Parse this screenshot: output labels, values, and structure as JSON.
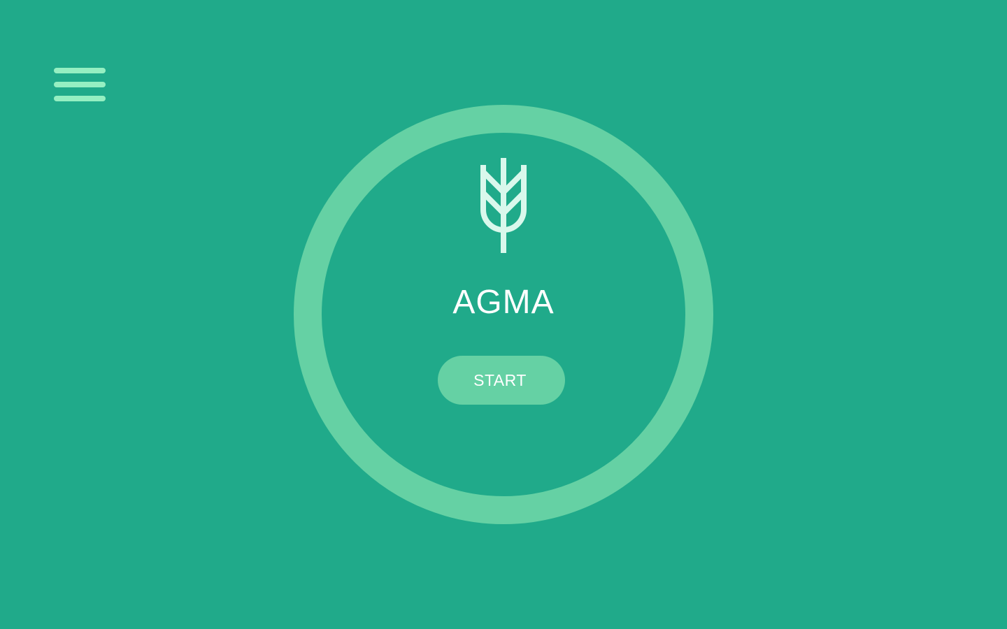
{
  "app": {
    "title": "AGMA"
  },
  "menu": {
    "icon": "hamburger-menu-icon"
  },
  "logo": {
    "icon": "wheat-icon"
  },
  "start_button": {
    "label": "START"
  },
  "colors": {
    "background": "#20aa8a",
    "ring": "#65d1a4",
    "button": "#65d1a4",
    "menu_icon": "#95efc2",
    "logo_icon": "#d9f8ec",
    "text": "#ffffff"
  }
}
